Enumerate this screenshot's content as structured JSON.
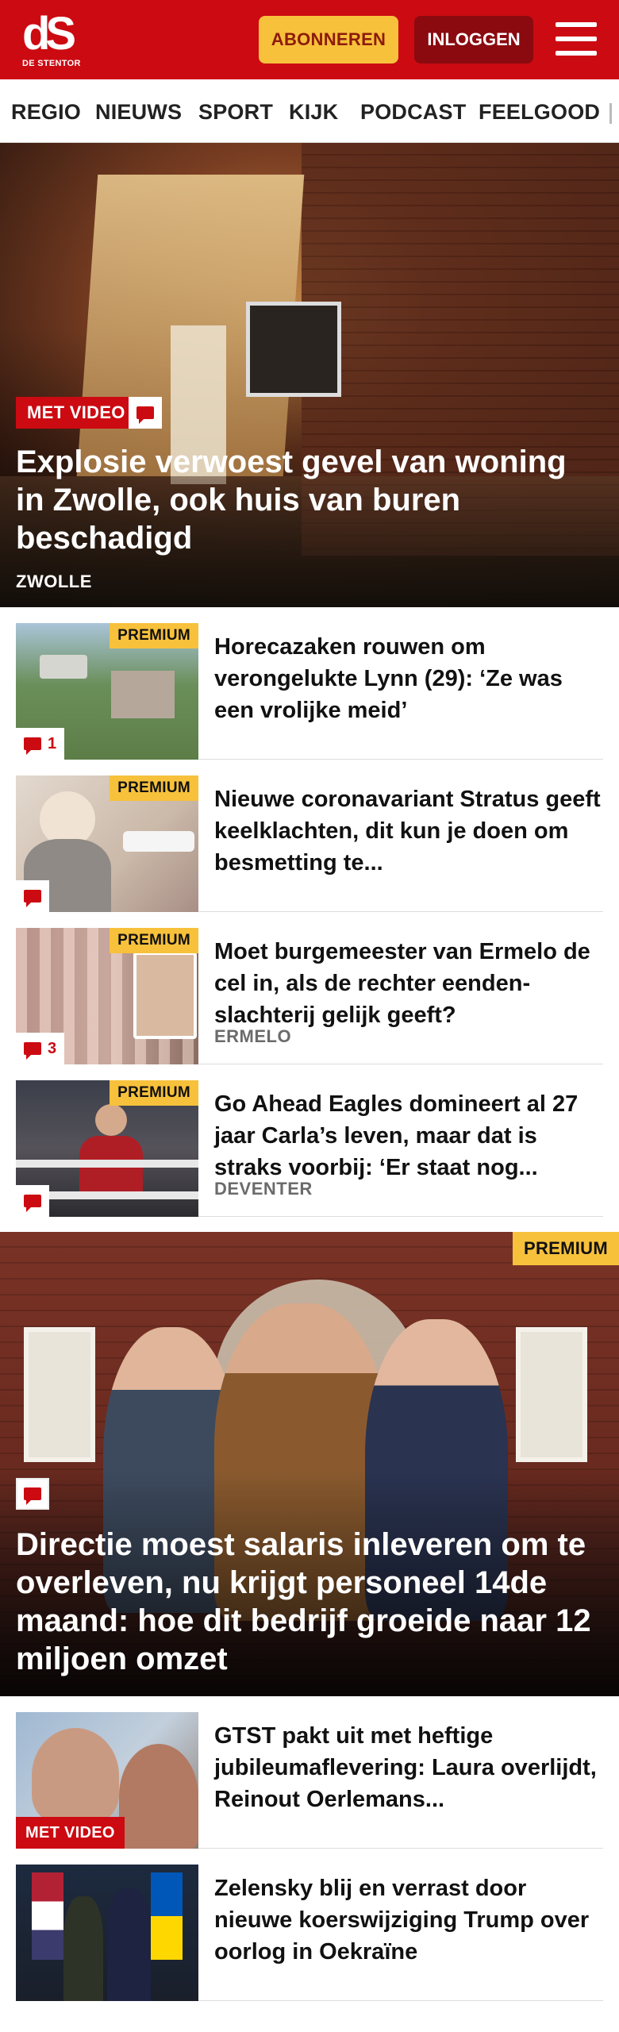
{
  "header": {
    "logo_mark": "dS",
    "logo_sub": "DE STENTOR",
    "subscribe_label": "ABONNEREN",
    "login_label": "INLOGGEN",
    "menu_icon": "hamburger-menu-icon",
    "brand_color": "#cc0a12",
    "accent_color": "#f7c13b"
  },
  "nav": {
    "items": [
      "REGIO",
      "NIEUWS",
      "SPORT",
      "KIJK",
      "PODCAST",
      "FEELGOOD"
    ]
  },
  "hero": {
    "badge": "MET VIDEO",
    "comment_icon": "comment-icon",
    "title": "Explosie verwoest gevel van woning in Zwolle, ook huis van buren beschadigd",
    "location": "ZWOLLE"
  },
  "articles": [
    {
      "premium": "PREMIUM",
      "comments": "1",
      "title": "Horecazaken rouwen om verongelukte Lynn (29): ‘Ze was een vrolijke meid’",
      "location": ""
    },
    {
      "premium": "PREMIUM",
      "comments": "",
      "title": "Nieuwe coronavariant Stratus geeft keelklachten, dit kun je doen om besmetting te...",
      "location": ""
    },
    {
      "premium": "PREMIUM",
      "comments": "3",
      "title": "Moet burgemeester van Ermelo de cel in, als de rechter eenden-slachterij gelijk geeft?",
      "location": "ERMELO"
    },
    {
      "premium": "PREMIUM",
      "comments": "",
      "title": "Go Ahead Eagles domineert al 27 jaar Carla’s leven, maar dat is straks voorbij: ‘Er staat nog...",
      "location": "DEVENTER"
    }
  ],
  "hero2": {
    "premium": "PREMIUM",
    "title": "Directie moest salaris inleveren om te overleven, nu krijgt personeel 14de maand: hoe dit bedrijf groeide naar 12 miljoen omzet"
  },
  "articles2": [
    {
      "badge": "MET VIDEO",
      "title": "GTST pakt uit met heftige jubileumaflevering: Laura overlijdt, Reinout Oerlemans..."
    },
    {
      "badge": "",
      "title": "Zelensky blij en verrast door nieuwe koerswijziging Trump over oorlog in Oekraïne"
    }
  ]
}
